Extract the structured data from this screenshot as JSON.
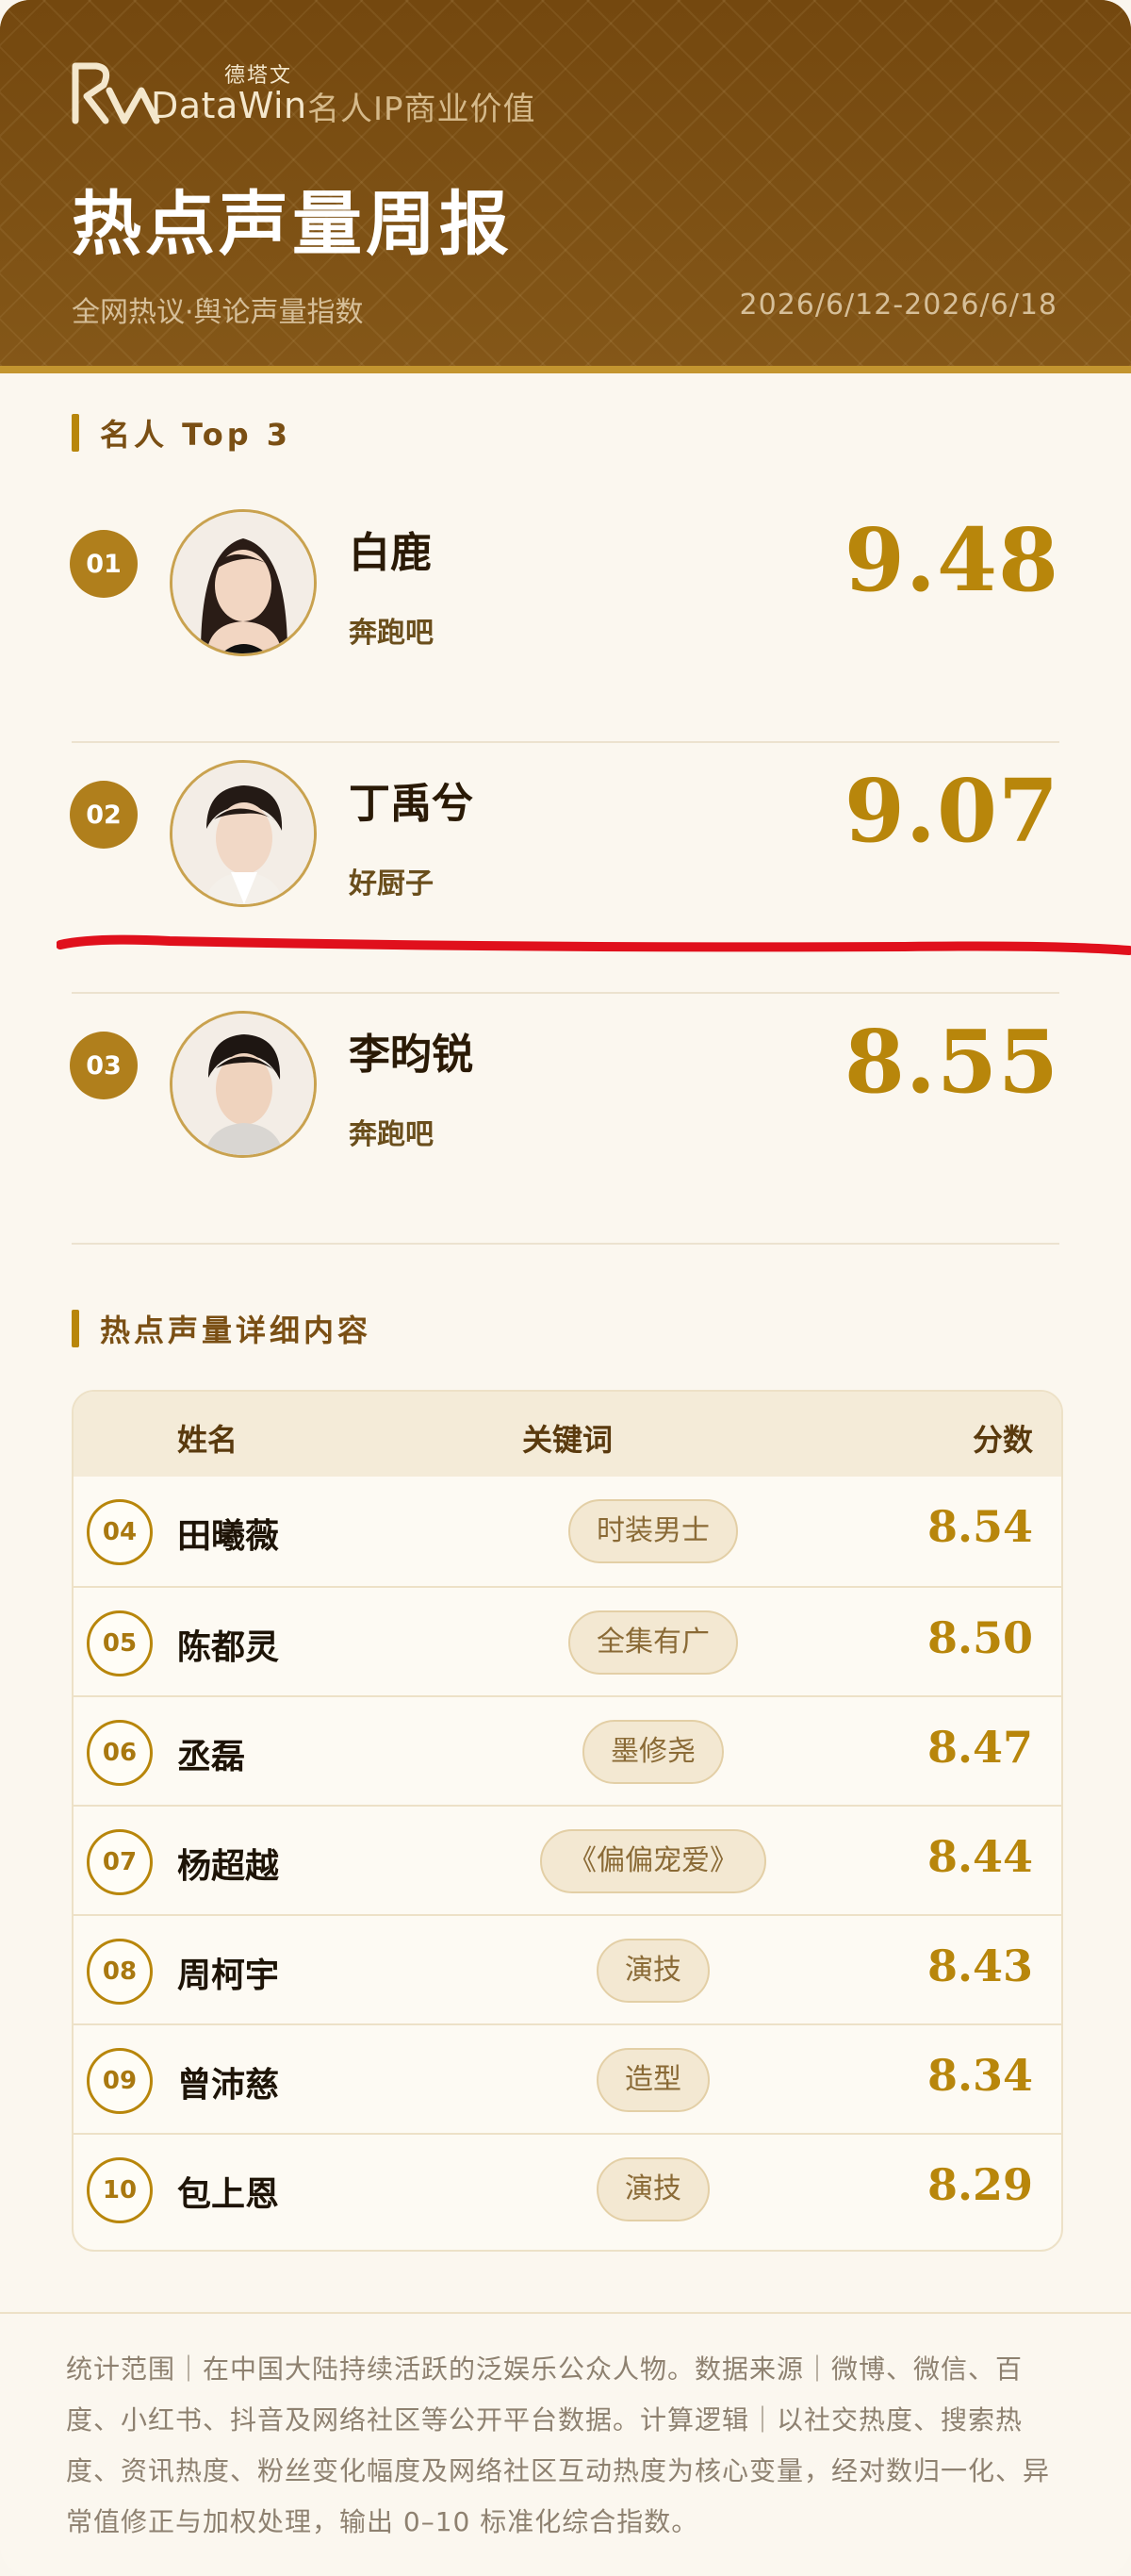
{
  "brand": {
    "name_cn": "德塔文",
    "name_en": "DataWin",
    "tagline": "名人IP商业价值"
  },
  "report": {
    "title": "热点声量周报",
    "subtitle": "全网热议·舆论声量指数",
    "date_range": "2026/6/12-2026/6/18"
  },
  "sections": {
    "top3_title": "名人 Top 3",
    "detail_title": "热点声量详细内容"
  },
  "top3": [
    {
      "rank": "01",
      "name": "白鹿",
      "show": "奔跑吧",
      "score": "9.48"
    },
    {
      "rank": "02",
      "name": "丁禹兮",
      "show": "好厨子",
      "score": "9.07"
    },
    {
      "rank": "03",
      "name": "李昀锐",
      "show": "奔跑吧",
      "score": "8.55"
    }
  ],
  "table": {
    "headers": {
      "name": "姓名",
      "keyword": "关键词",
      "score": "分数"
    },
    "rows": [
      {
        "rank": "04",
        "name": "田曦薇",
        "keyword": "时装男士",
        "score": "8.54"
      },
      {
        "rank": "05",
        "name": "陈都灵",
        "keyword": "全集有广",
        "score": "8.50"
      },
      {
        "rank": "06",
        "name": "丞磊",
        "keyword": "墨修尧",
        "score": "8.47"
      },
      {
        "rank": "07",
        "name": "杨超越",
        "keyword": "《偏偏宠爱》",
        "score": "8.44"
      },
      {
        "rank": "08",
        "name": "周柯宇",
        "keyword": "演技",
        "score": "8.43"
      },
      {
        "rank": "09",
        "name": "曾沛慈",
        "keyword": "造型",
        "score": "8.34"
      },
      {
        "rank": "10",
        "name": "包上恩",
        "keyword": "演技",
        "score": "8.29"
      }
    ]
  },
  "footer": {
    "note": "统计范围｜在中国大陆持续活跃的泛娱乐公众人物。数据来源｜微博、微信、百度、小红书、抖音及网络社区等公开平台数据。计算逻辑｜以社交热度、搜索热度、资讯热度、粉丝变化幅度及网络社区互动热度为核心变量，经对数归一化、异常值修正与加权处理，输出 0–10 标准化综合指数。"
  },
  "colors": {
    "header_brown": "#7a4f14",
    "gold": "#b8860b",
    "annotation_red": "#e0101c"
  }
}
